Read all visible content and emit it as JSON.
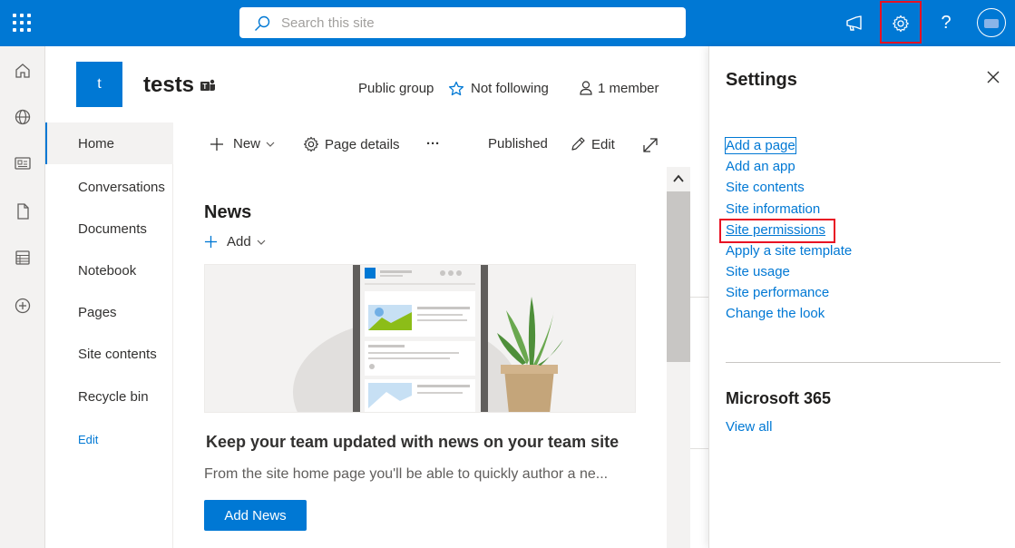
{
  "topbar": {
    "search_placeholder": "Search this site",
    "icons": [
      "app-launcher-icon",
      "search-icon",
      "megaphone-icon",
      "gear-icon",
      "help-icon",
      "avatar"
    ],
    "help_label": "?"
  },
  "site": {
    "logo_letter": "t",
    "title": "tests",
    "group_type": "Public group",
    "follow_label": "Not following",
    "members_label": "1 member"
  },
  "leftnav": {
    "items": [
      {
        "label": "Home",
        "selected": true
      },
      {
        "label": "Conversations"
      },
      {
        "label": "Documents"
      },
      {
        "label": "Notebook"
      },
      {
        "label": "Pages"
      },
      {
        "label": "Site contents"
      },
      {
        "label": "Recycle bin"
      }
    ],
    "edit_label": "Edit"
  },
  "commandbar": {
    "new_label": "New",
    "page_details_label": "Page details",
    "more_label": "···",
    "status_label": "Published",
    "edit_label": "Edit"
  },
  "news": {
    "heading": "News",
    "add_label": "Add",
    "promo_title": "Keep your team updated with news on your team site",
    "promo_text": "From the site home page you'll be able to quickly author a ne...",
    "add_news_button": "Add News"
  },
  "settings_panel": {
    "title": "Settings",
    "links": [
      "Add a page",
      "Add an app",
      "Site contents",
      "Site information",
      "Site permissions",
      "Apply a site template",
      "Site usage",
      "Site performance",
      "Change the look"
    ],
    "m365_heading": "Microsoft 365",
    "view_all": "View all"
  },
  "colors": {
    "brand": "#0078d4",
    "highlight": "#e81123"
  }
}
